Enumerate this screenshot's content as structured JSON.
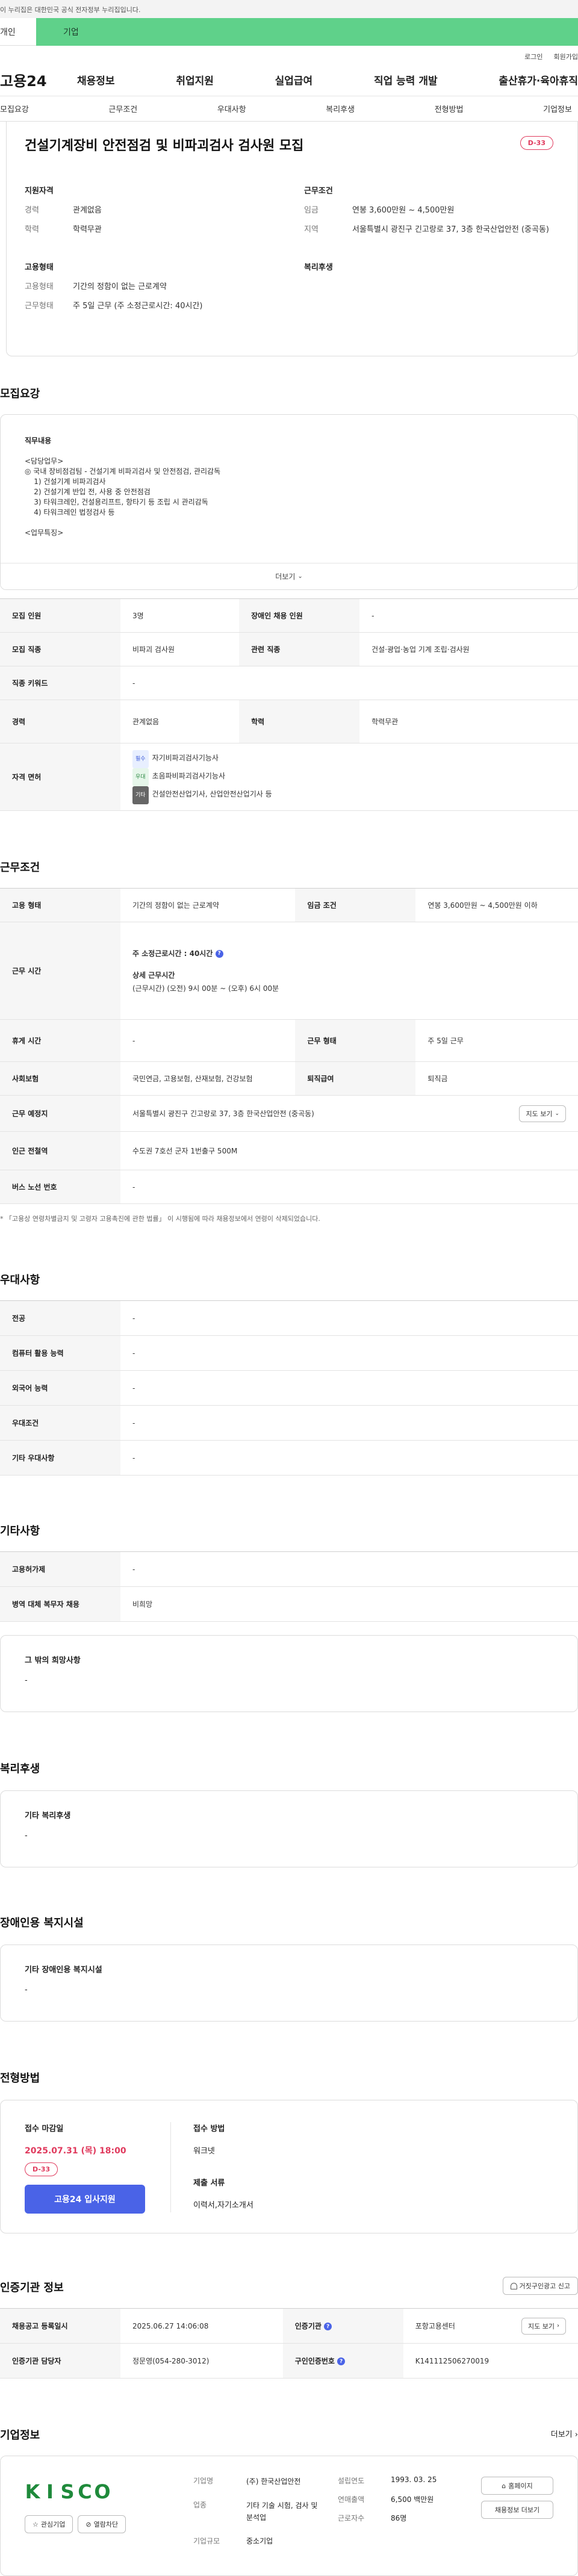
{
  "gov_notice": "이 누리집은 대한민국 공식 전자정부 누리집입니다.",
  "site_tabs": {
    "person": "개인",
    "company": "기업"
  },
  "util_links": [
    "로그인",
    "회원가입"
  ],
  "logo": "고용24",
  "gnb": [
    "채용정보",
    "취업지원",
    "실업급여",
    "직업 능력 개발",
    "출산휴가·육아휴직"
  ],
  "subnav": [
    "모집요강",
    "근무조건",
    "우대사항",
    "복리후생",
    "전형방법",
    "기업정보"
  ],
  "header": {
    "title": "건설기계장비 안전점검 및 비파괴검사 검사원 모집",
    "dday": "D-33",
    "qual_head": "지원자격",
    "qual": [
      {
        "k": "경력",
        "v": "관계없음"
      },
      {
        "k": "학력",
        "v": "학력무관"
      }
    ],
    "cond_head": "근무조건",
    "cond": [
      {
        "k": "임금",
        "v": "연봉 3,600만원 ~ 4,500만원"
      },
      {
        "k": "지역",
        "v": "서울특별시 광진구 긴고랑로 37, 3층 한국산업안전 (중곡동)"
      }
    ],
    "emp_head": "고용형태",
    "emp": [
      {
        "k": "고용형태",
        "v": "기간의 정함이 없는 근로계약"
      },
      {
        "k": "근무형태",
        "v": "주 5일 근무 (주 소정근로시간: 40시간)"
      }
    ],
    "welfare_head": "복리후생"
  },
  "recruit": {
    "title": "모집요강",
    "duty_head": "직무내용",
    "duty_lines": [
      "<담당업무>",
      "◎ 국내 장비점검팀 - 건설기계 비파괴검사 및 안전점검, 관리감독",
      "    1) 건설기계 비파괴검사",
      "    2) 건설기계 반입 전, 사용 중 안전점검",
      "    3) 타워크레인, 건설용리프트, 항타기 등 조립 시 관리감독",
      "    4) 타워크레인 법정검사 등",
      "",
      "<업무특징>"
    ],
    "more": "더보기",
    "table": {
      "headcount_l": "모집 인원",
      "headcount_v": "3명",
      "disabled_l": "장애인 채용 인원",
      "disabled_v": "-",
      "job_l": "모집 직종",
      "job_v": "비파괴 검사원",
      "related_l": "관련 직종",
      "related_v": "건설·광업·농업 기계 조립·검사원",
      "keyword_l": "직종 키워드",
      "keyword_v": "-",
      "career_l": "경력",
      "career_v": "관계없음",
      "edu_l": "학력",
      "edu_v": "학력무관",
      "license_l": "자격 면허",
      "licenses": [
        {
          "tag": "필수",
          "name": "자기비파괴검사기능사"
        },
        {
          "tag": "우대",
          "name": "초음파비파괴검사기능사"
        },
        {
          "tag": "기타",
          "name": "건설안전산업기사, 산업안전산업기사 등"
        }
      ]
    }
  },
  "work": {
    "title": "근무조건",
    "emp_l": "고용 형태",
    "emp_v": "기간의 정함이 없는 근로계약",
    "wage_l": "임금 조건",
    "wage_v": "연봉 3,600만원 ~ 4,500만원 이하",
    "hours_l": "근무 시간",
    "hours_weekly": "주 소정근로시간 : 40시간",
    "hours_detail_head": "상세 근무시간",
    "hours_detail": "(근무시간) (오전) 9시 00분 ~ (오후) 6시 00분",
    "break_l": "휴게 시간",
    "break_v": "-",
    "form_l": "근무 형태",
    "form_v": "주 5일 근무",
    "ins_l": "사회보험",
    "ins_v": "국민연금, 고용보험, 산재보험, 건강보험",
    "sev_l": "퇴직급여",
    "sev_v": "퇴직금",
    "place_l": "근무 예정지",
    "place_v": "서울특별시 광진구 긴고랑로 37, 3층 한국산업안전 (중곡동)",
    "map_btn": "지도 보기",
    "subway_l": "인근 전철역",
    "subway_v": "수도권 7호선 군자 1번출구 500M",
    "bus_l": "버스 노선 번호",
    "bus_v": "-",
    "note": "* 「고용상 연령차별금지 및 고령자 고용촉진에 관한 법률」 이 시행됨에 따라 채용정보에서 연령이 삭제되었습니다."
  },
  "pref": {
    "title": "우대사항",
    "rows": [
      {
        "k": "전공",
        "v": "-"
      },
      {
        "k": "컴퓨터 활용 능력",
        "v": "-"
      },
      {
        "k": "외국어 능력",
        "v": "-"
      },
      {
        "k": "우대조건",
        "v": "-"
      },
      {
        "k": "기타 우대사항",
        "v": "-"
      }
    ]
  },
  "etc": {
    "title": "기타사항",
    "rows": [
      {
        "k": "고용허가제",
        "v": "-"
      },
      {
        "k": "병역 대체 복무자 채용",
        "v": "비희망"
      }
    ],
    "other_head": "그 밖의 희망사항",
    "other_v": "-"
  },
  "welfare": {
    "title": "복리후생",
    "head": "기타 복리후생",
    "v": "-"
  },
  "disabled": {
    "title": "장애인용 복지시설",
    "head": "기타 장애인용 복지시설",
    "v": "-"
  },
  "selection": {
    "title": "전형방법",
    "deadline_head": "접수 마감일",
    "deadline": "2025.07.31 (목) 18:00",
    "dday": "D-33",
    "apply_btn": "고용24 입사지원",
    "method_head": "접수 방법",
    "method_v": "워크넷",
    "docs_head": "제출 서류",
    "docs_v": "이력서,자기소개서"
  },
  "cert": {
    "title": "인증기관 정보",
    "report_btn": "거짓구인광고 신고",
    "reg_l": "채용공고 등록일시",
    "reg_v": "2025.06.27 14:06:08",
    "org_l": "인증기관",
    "org_v": "포항고용센터",
    "map_btn": "지도 보기",
    "staff_l": "인증기관 담당자",
    "staff_v": "정문영(054-280-3012)",
    "num_l": "구인인증번호",
    "num_v": "K141112506270019"
  },
  "company": {
    "title": "기업정보",
    "more": "더보기",
    "logo_letters": [
      "K",
      "I",
      "S",
      "C",
      "O"
    ],
    "fav_btn": "관심기업",
    "block_btn": "열람차단",
    "name_l": "기업명",
    "name_v": "(주) 한국산업안전",
    "industry_l": "업종",
    "industry_v": "기타 기술 시험, 검사 및 분석업",
    "size_l": "기업규모",
    "size_v": "중소기업",
    "founded_l": "설립연도",
    "founded_v": "1993. 03. 25",
    "sales_l": "연매출액",
    "sales_v": "6,500 백만원",
    "staff_l": "근로자수",
    "staff_v": "86명",
    "home_btn": "홈페이지",
    "jobs_btn": "채용정보 더보기"
  },
  "colors": {
    "accent": "#4a63e7",
    "dday": "#e03a5d",
    "company_tab": "#5fd18a",
    "kisco_green": "#1f8a3b"
  }
}
